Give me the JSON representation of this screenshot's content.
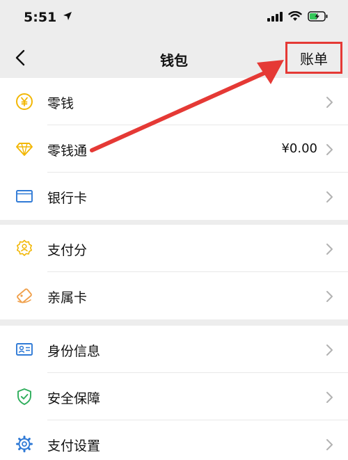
{
  "status_bar": {
    "time": "5:51"
  },
  "nav": {
    "title": "钱包",
    "action_label": "账单"
  },
  "groups": [
    {
      "items": [
        {
          "label": "零钱",
          "value": ""
        },
        {
          "label": "零钱通",
          "value": "¥0.00"
        },
        {
          "label": "银行卡",
          "value": ""
        }
      ]
    },
    {
      "items": [
        {
          "label": "支付分",
          "value": ""
        },
        {
          "label": "亲属卡",
          "value": ""
        }
      ]
    },
    {
      "items": [
        {
          "label": "身份信息",
          "value": ""
        },
        {
          "label": "安全保障",
          "value": ""
        },
        {
          "label": "支付设置",
          "value": ""
        }
      ]
    }
  ],
  "colors": {
    "highlight_red": "#e53935",
    "icon_yellow": "#f2b705",
    "icon_blue": "#2f7ad6",
    "icon_orange": "#f0a04b",
    "icon_green": "#2fae5c",
    "battery_green": "#34c759"
  },
  "icons": {
    "status": [
      "location-arrow-icon",
      "signal-icon",
      "wifi-icon",
      "battery-charging-icon"
    ],
    "nav_back": "chevron-left-icon",
    "rows": [
      "yen-coin-icon",
      "diamond-icon",
      "bank-card-icon",
      "badge-person-icon",
      "tag-card-icon",
      "id-card-icon",
      "shield-check-icon",
      "gear-icon"
    ]
  }
}
